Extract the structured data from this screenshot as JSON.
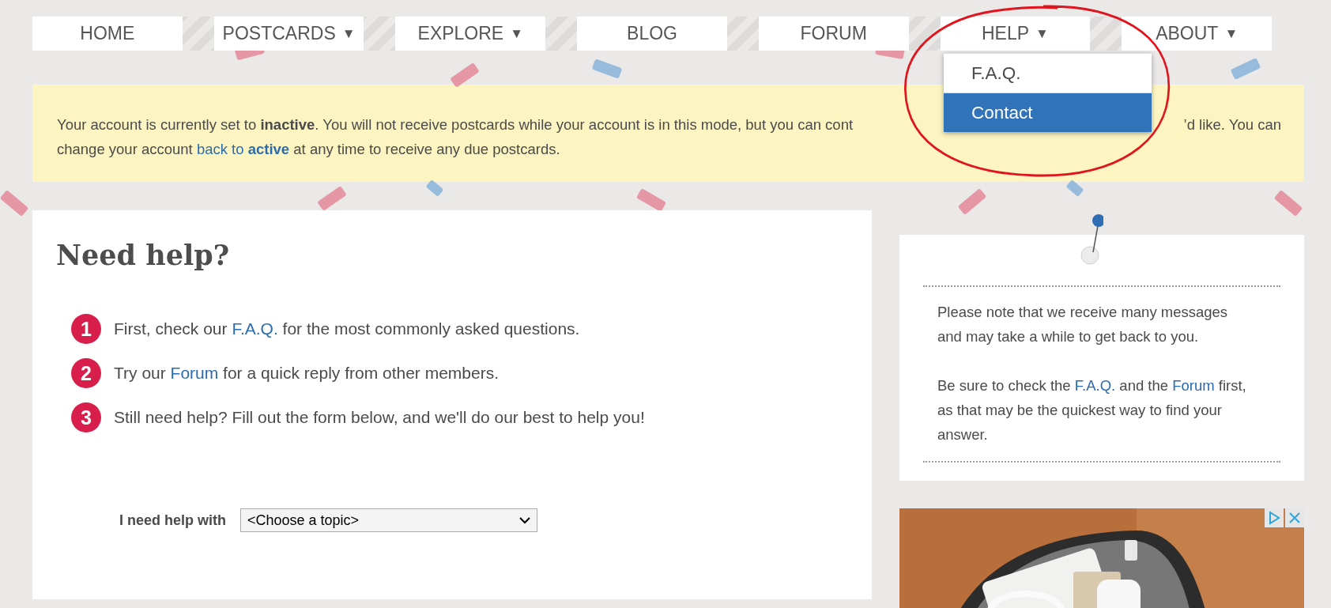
{
  "nav": {
    "items": [
      {
        "label": "HOME"
      },
      {
        "label": "POSTCARDS",
        "caret": "▼"
      },
      {
        "label": "EXPLORE",
        "caret": "▼"
      },
      {
        "label": "BLOG"
      },
      {
        "label": "FORUM"
      },
      {
        "label": "HELP",
        "caret": "▼"
      },
      {
        "label": "ABOUT",
        "caret": "▼"
      }
    ],
    "open_menu": {
      "items": [
        {
          "label": "F.A.Q.",
          "selected": false
        },
        {
          "label": "Contact",
          "selected": true
        }
      ]
    }
  },
  "notice": {
    "line_1_start": "Your account is currently set to **inactive**. You will not receive postcards while your account is in this mode, but you can cont",
    "line_1_end": "’d like. You can",
    "line_2_before": "change your account ",
    "line_2_link": "back to **active**",
    "line_2_after": " at any time to receive any due postcards."
  },
  "help": {
    "title": "Need help?",
    "steps": [
      {
        "number": "1",
        "before": "First, check our ",
        "link": "F.A.Q.",
        "after": " for the most commonly asked questions."
      },
      {
        "number": "2",
        "before": "Try our ",
        "link": "Forum",
        "after": " for a quick reply from other members."
      },
      {
        "number": "3",
        "before": "Still need help? Fill out the form below, and we'll do our best to help you!"
      }
    ],
    "topic_label": "I need help with",
    "topic_value": "<Choose a topic>"
  },
  "side_note": {
    "paragraph_1": "Please note that we receive many messages and may take a while to get back to you.",
    "paragraph_2_parts": [
      "Be sure to check the ",
      "F.A.Q.",
      " and the ",
      "Forum",
      " first, as that may be the quickest way to find your answer."
    ]
  }
}
